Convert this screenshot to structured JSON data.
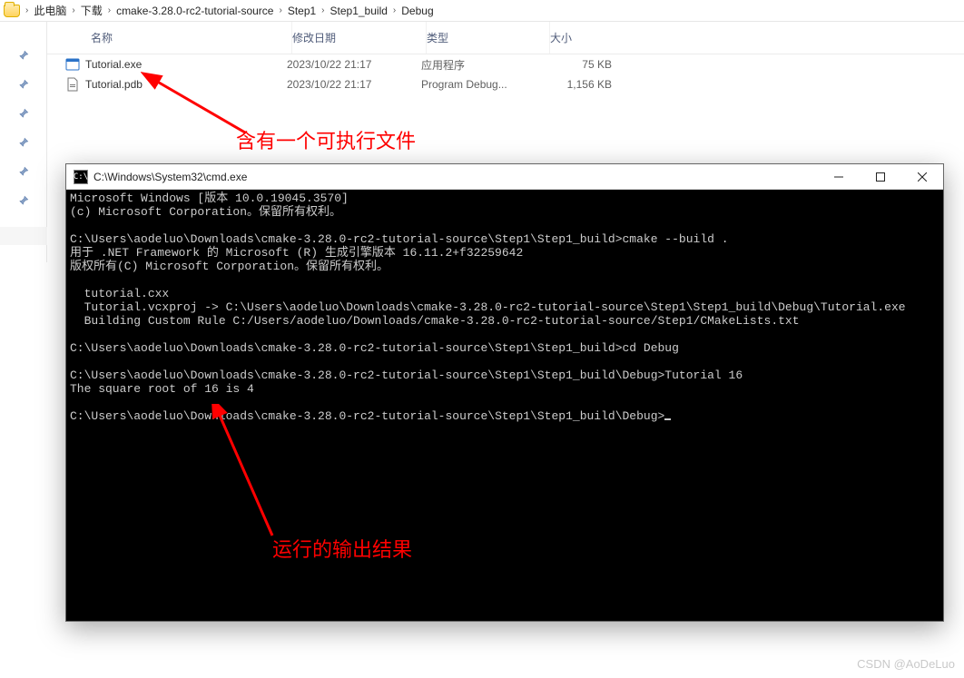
{
  "breadcrumb": {
    "items": [
      "此电脑",
      "下载",
      "cmake-3.28.0-rc2-tutorial-source",
      "Step1",
      "Step1_build",
      "Debug"
    ]
  },
  "columns": {
    "name": "名称",
    "date": "修改日期",
    "type": "类型",
    "size": "大小"
  },
  "files": [
    {
      "name": "Tutorial.exe",
      "date": "2023/10/22 21:17",
      "type": "应用程序",
      "size": "75 KB",
      "icon": "exe"
    },
    {
      "name": "Tutorial.pdb",
      "date": "2023/10/22 21:17",
      "type": "Program Debug...",
      "size": "1,156 KB",
      "icon": "pdb"
    }
  ],
  "annotations": {
    "exe_note": "含有一个可执行文件",
    "output_note": "运行的输出结果"
  },
  "cmd": {
    "title": "C:\\Windows\\System32\\cmd.exe",
    "lines": [
      "Microsoft Windows [版本 10.0.19045.3570]",
      "(c) Microsoft Corporation。保留所有权利。",
      "",
      "C:\\Users\\aodeluo\\Downloads\\cmake-3.28.0-rc2-tutorial-source\\Step1\\Step1_build>cmake --build .",
      "用于 .NET Framework 的 Microsoft (R) 生成引擎版本 16.11.2+f32259642",
      "版权所有(C) Microsoft Corporation。保留所有权利。",
      "",
      "  tutorial.cxx",
      "  Tutorial.vcxproj -> C:\\Users\\aodeluo\\Downloads\\cmake-3.28.0-rc2-tutorial-source\\Step1\\Step1_build\\Debug\\Tutorial.exe",
      "  Building Custom Rule C:/Users/aodeluo/Downloads/cmake-3.28.0-rc2-tutorial-source/Step1/CMakeLists.txt",
      "",
      "C:\\Users\\aodeluo\\Downloads\\cmake-3.28.0-rc2-tutorial-source\\Step1\\Step1_build>cd Debug",
      "",
      "C:\\Users\\aodeluo\\Downloads\\cmake-3.28.0-rc2-tutorial-source\\Step1\\Step1_build\\Debug>Tutorial 16",
      "The square root of 16 is 4",
      "",
      "C:\\Users\\aodeluo\\Downloads\\cmake-3.28.0-rc2-tutorial-source\\Step1\\Step1_build\\Debug>"
    ]
  },
  "watermark": "CSDN @AoDeLuo"
}
